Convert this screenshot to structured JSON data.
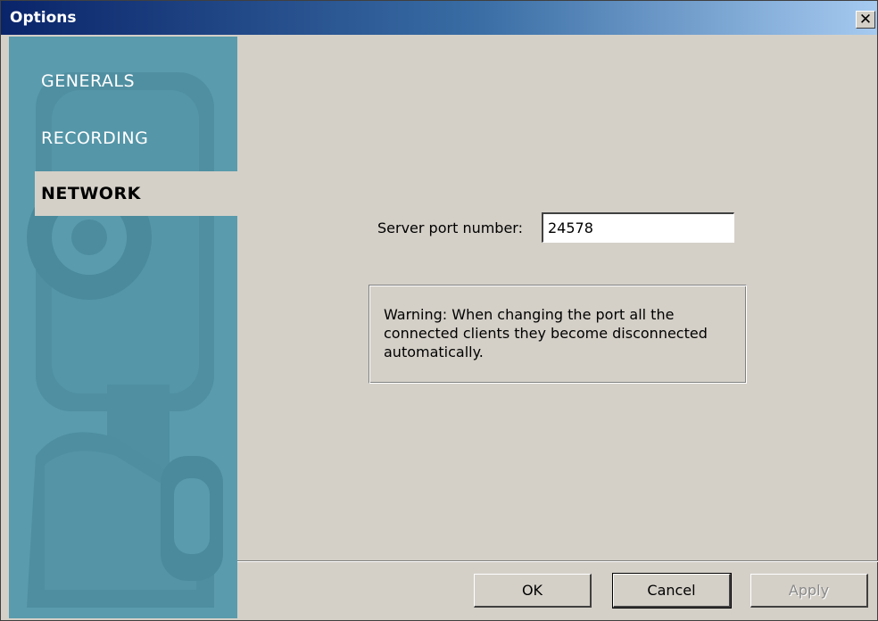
{
  "window": {
    "title": "Options",
    "close_glyph": "✕"
  },
  "sidebar": {
    "items": [
      {
        "label": "GENERALS",
        "active": false
      },
      {
        "label": "RECORDING",
        "active": false
      },
      {
        "label": "NETWORK",
        "active": true
      }
    ]
  },
  "network": {
    "port_label": "Server port number:",
    "port_value": "24578",
    "warning": "Warning: When changing the port all the connected clients they become disconnected automatically."
  },
  "footer": {
    "ok_label": "OK",
    "cancel_label": "Cancel",
    "apply_label": "Apply"
  },
  "colors": {
    "titlebar_start": "#0a246a",
    "titlebar_end": "#a6caf0",
    "sidebar_bg": "#5a9bad",
    "dialog_bg": "#d4d0c8"
  },
  "icons": {
    "close": "close-icon",
    "sidebar_art": "webcam-illustration"
  }
}
